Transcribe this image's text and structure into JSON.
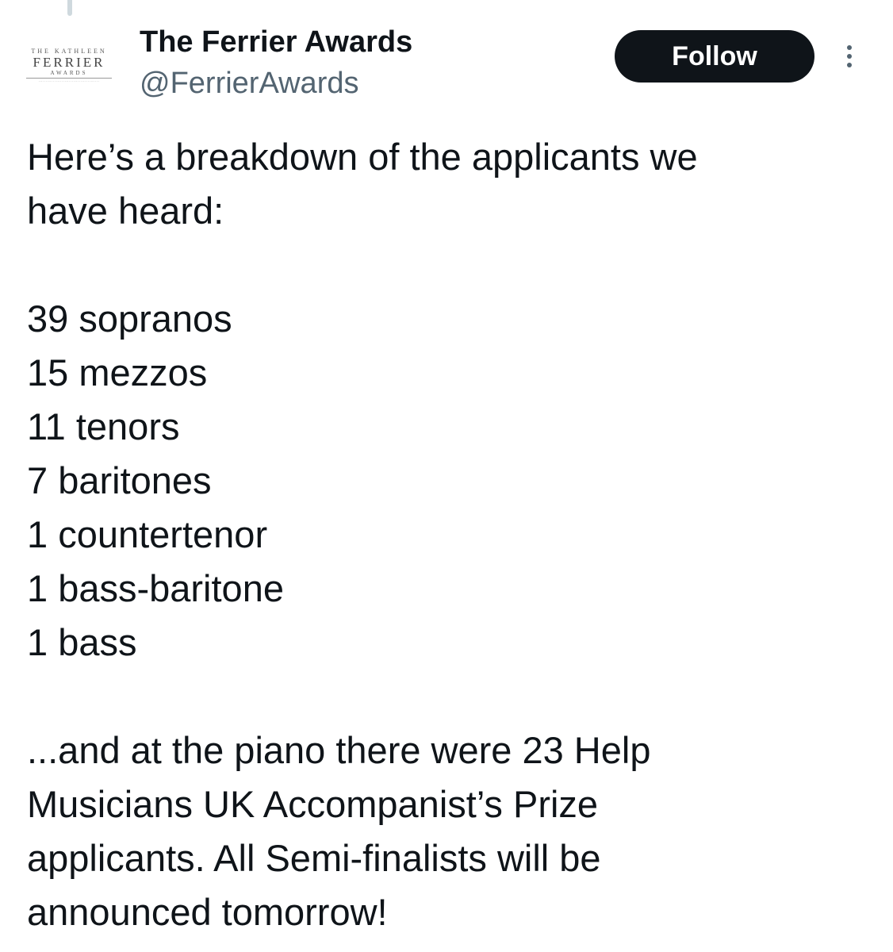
{
  "account": {
    "name": "The Ferrier Awards",
    "handle": "@FerrierAwards",
    "avatar_logo": {
      "top": "THE KATHLEEN",
      "main": "FERRIER",
      "sub": "AWARDS"
    }
  },
  "actions": {
    "follow_label": "Follow",
    "more_icon": "more-horizontal-icon"
  },
  "tweet": {
    "intro_lines": [
      "Here’s a breakdown of the applicants we",
      "have heard:"
    ],
    "breakdown": [
      "39 sopranos",
      "15 mezzos",
      "11 tenors",
      "7 baritones",
      "1 countertenor",
      "1 bass-baritone",
      "1 bass"
    ],
    "closing_lines": [
      "...and at the piano there were 23 Help",
      "Musicians UK Accompanist’s Prize",
      "applicants. All Semi-finalists will be",
      "announced tomorrow!"
    ]
  },
  "colors": {
    "text": "#0f1419",
    "secondary": "#536471",
    "button": "#0f1419",
    "thread_line": "#cfd9de"
  }
}
